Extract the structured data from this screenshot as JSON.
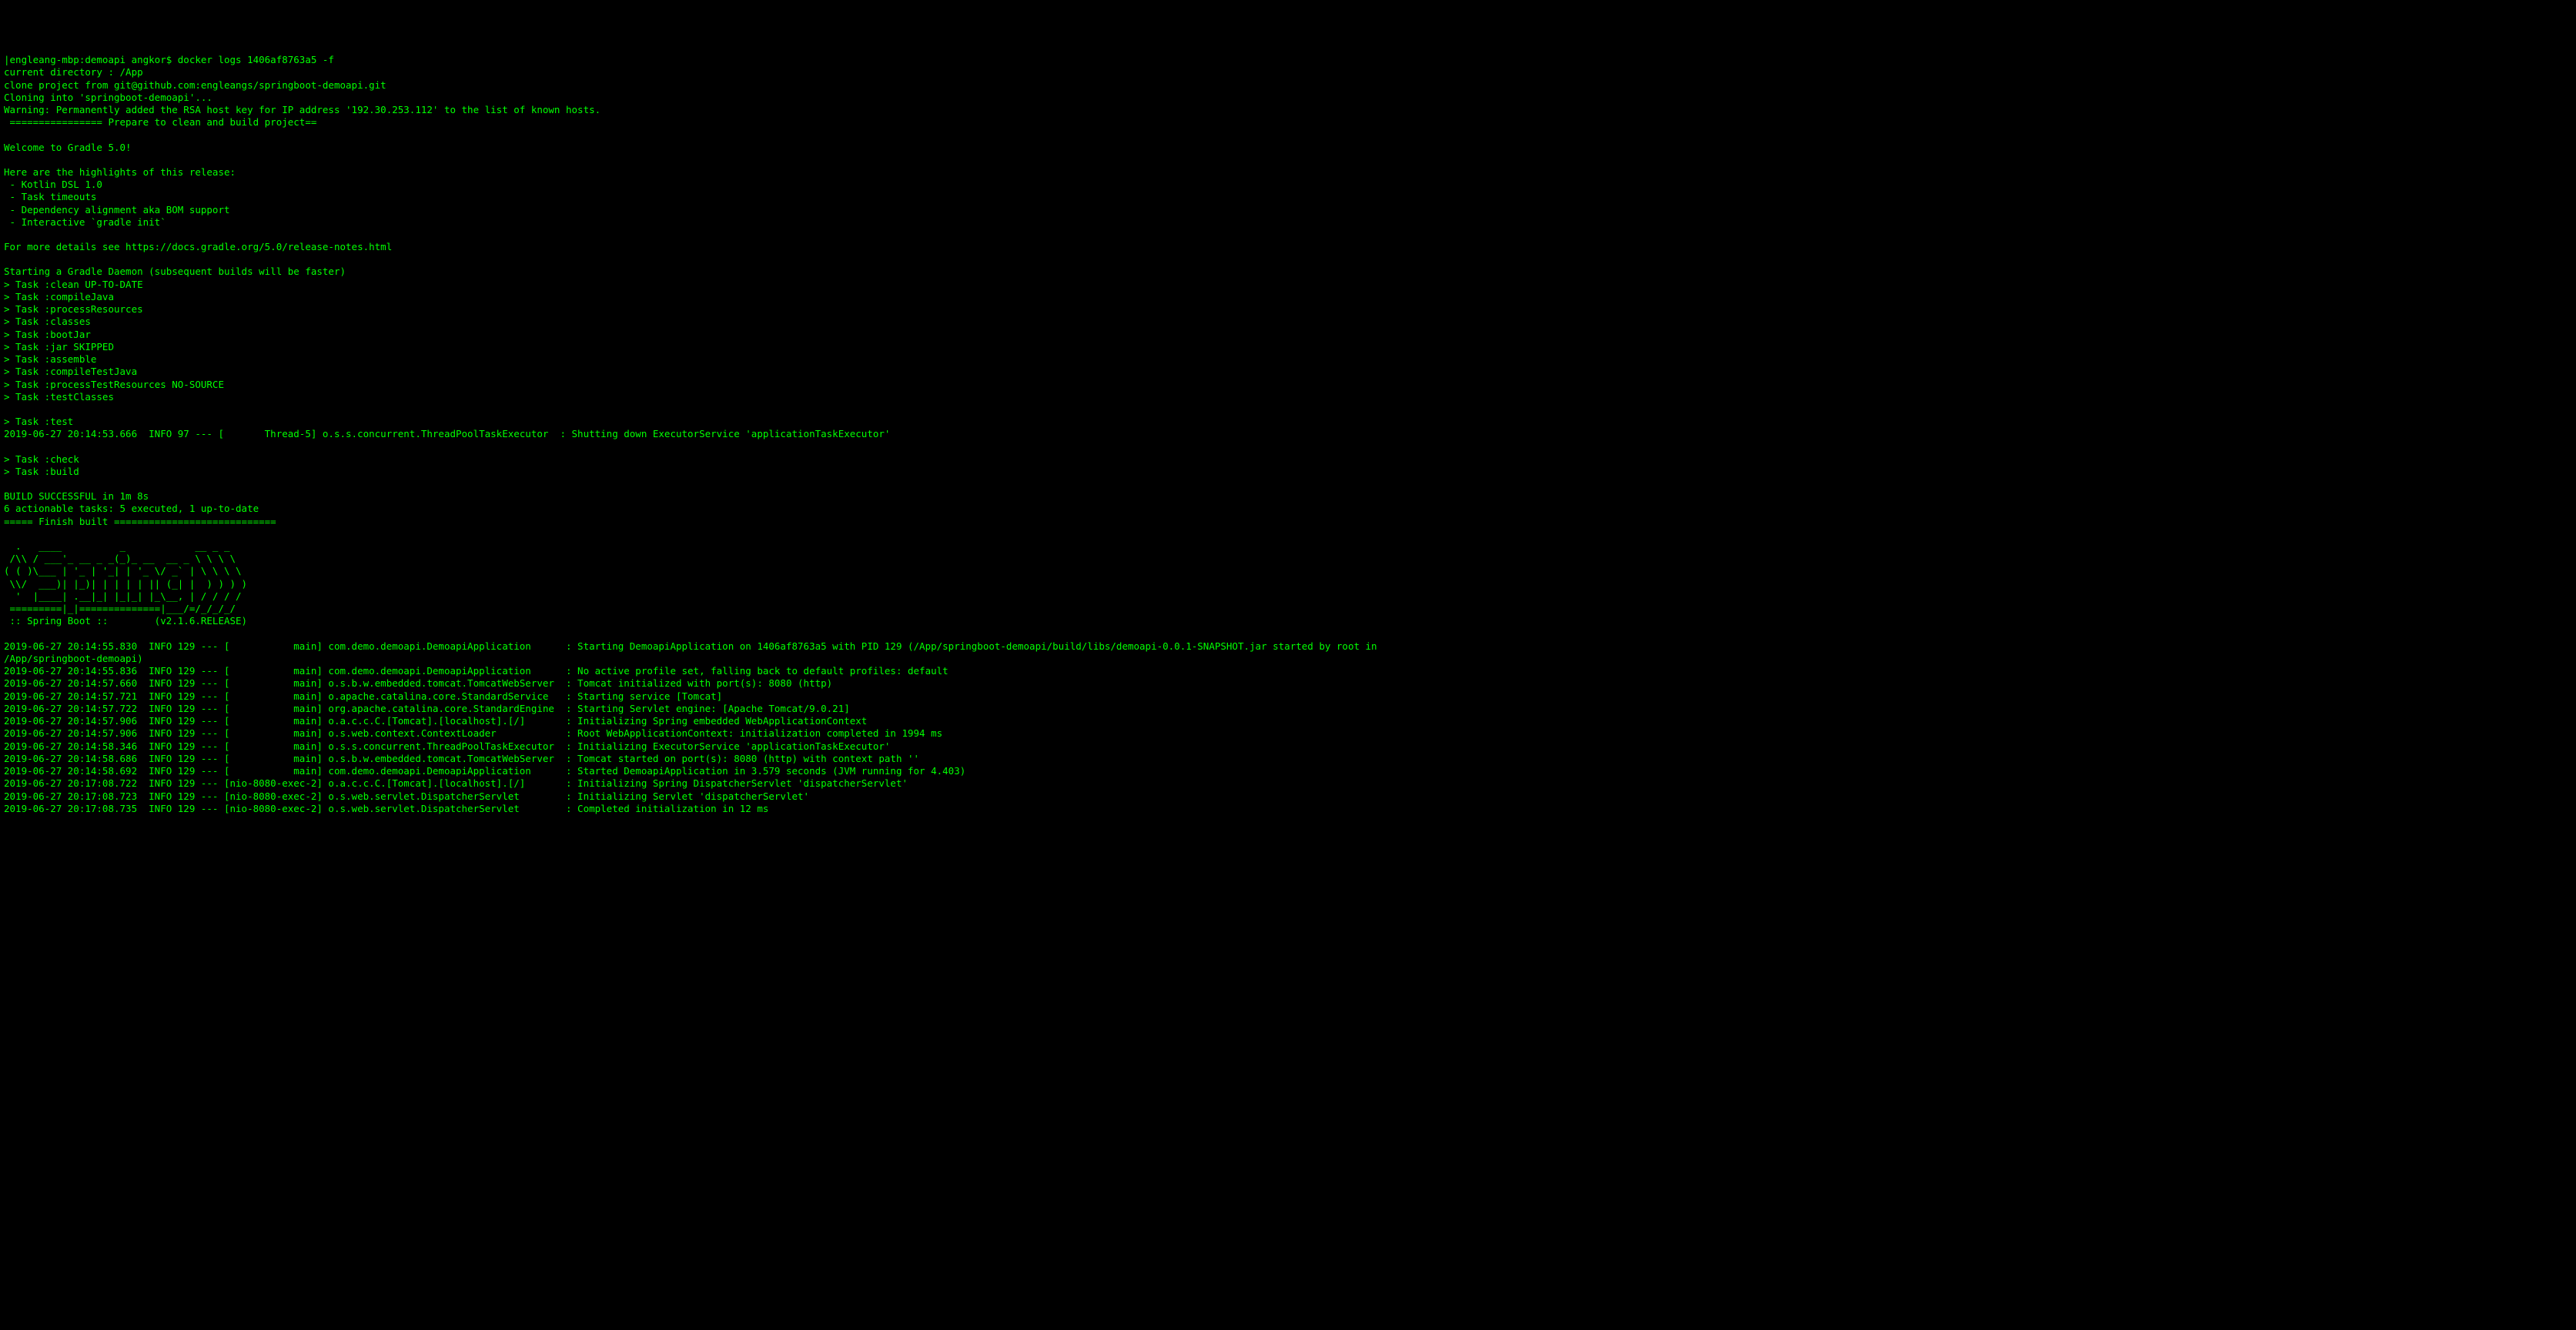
{
  "terminal": {
    "lines": [
      "|engleang-mbp:demoapi angkor$ docker logs 1406af8763a5 -f",
      "current directory : /App",
      "clone project from git@github.com:engleangs/springboot-demoapi.git",
      "Cloning into 'springboot-demoapi'...",
      "Warning: Permanently added the RSA host key for IP address '192.30.253.112' to the list of known hosts.",
      " ================ Prepare to clean and build project==",
      "",
      "Welcome to Gradle 5.0!",
      "",
      "Here are the highlights of this release:",
      " - Kotlin DSL 1.0",
      " - Task timeouts",
      " - Dependency alignment aka BOM support",
      " - Interactive `gradle init`",
      "",
      "For more details see https://docs.gradle.org/5.0/release-notes.html",
      "",
      "Starting a Gradle Daemon (subsequent builds will be faster)",
      "> Task :clean UP-TO-DATE",
      "> Task :compileJava",
      "> Task :processResources",
      "> Task :classes",
      "> Task :bootJar",
      "> Task :jar SKIPPED",
      "> Task :assemble",
      "> Task :compileTestJava",
      "> Task :processTestResources NO-SOURCE",
      "> Task :testClasses",
      "",
      "> Task :test",
      "2019-06-27 20:14:53.666  INFO 97 --- [       Thread-5] o.s.s.concurrent.ThreadPoolTaskExecutor  : Shutting down ExecutorService 'applicationTaskExecutor'",
      "",
      "> Task :check",
      "> Task :build",
      "",
      "BUILD SUCCESSFUL in 1m 8s",
      "6 actionable tasks: 5 executed, 1 up-to-date",
      "===== Finish built ============================",
      "",
      "  .   ____          _            __ _ _",
      " /\\\\ / ___'_ __ _ _(_)_ __  __ _ \\ \\ \\ \\",
      "( ( )\\___ | '_ | '_| | '_ \\/ _` | \\ \\ \\ \\",
      " \\\\/  ___)| |_)| | | | | || (_| |  ) ) ) )",
      "  '  |____| .__|_| |_|_| |_\\__, | / / / /",
      " =========|_|==============|___/=/_/_/_/",
      " :: Spring Boot ::        (v2.1.6.RELEASE)",
      "",
      "2019-06-27 20:14:55.830  INFO 129 --- [           main] com.demo.demoapi.DemoapiApplication      : Starting DemoapiApplication on 1406af8763a5 with PID 129 (/App/springboot-demoapi/build/libs/demoapi-0.0.1-SNAPSHOT.jar started by root in",
      "/App/springboot-demoapi)",
      "2019-06-27 20:14:55.836  INFO 129 --- [           main] com.demo.demoapi.DemoapiApplication      : No active profile set, falling back to default profiles: default",
      "2019-06-27 20:14:57.660  INFO 129 --- [           main] o.s.b.w.embedded.tomcat.TomcatWebServer  : Tomcat initialized with port(s): 8080 (http)",
      "2019-06-27 20:14:57.721  INFO 129 --- [           main] o.apache.catalina.core.StandardService   : Starting service [Tomcat]",
      "2019-06-27 20:14:57.722  INFO 129 --- [           main] org.apache.catalina.core.StandardEngine  : Starting Servlet engine: [Apache Tomcat/9.0.21]",
      "2019-06-27 20:14:57.906  INFO 129 --- [           main] o.a.c.c.C.[Tomcat].[localhost].[/]       : Initializing Spring embedded WebApplicationContext",
      "2019-06-27 20:14:57.906  INFO 129 --- [           main] o.s.web.context.ContextLoader            : Root WebApplicationContext: initialization completed in 1994 ms",
      "2019-06-27 20:14:58.346  INFO 129 --- [           main] o.s.s.concurrent.ThreadPoolTaskExecutor  : Initializing ExecutorService 'applicationTaskExecutor'",
      "2019-06-27 20:14:58.686  INFO 129 --- [           main] o.s.b.w.embedded.tomcat.TomcatWebServer  : Tomcat started on port(s): 8080 (http) with context path ''",
      "2019-06-27 20:14:58.692  INFO 129 --- [           main] com.demo.demoapi.DemoapiApplication      : Started DemoapiApplication in 3.579 seconds (JVM running for 4.403)",
      "2019-06-27 20:17:08.722  INFO 129 --- [nio-8080-exec-2] o.a.c.c.C.[Tomcat].[localhost].[/]       : Initializing Spring DispatcherServlet 'dispatcherServlet'",
      "2019-06-27 20:17:08.723  INFO 129 --- [nio-8080-exec-2] o.s.web.servlet.DispatcherServlet        : Initializing Servlet 'dispatcherServlet'",
      "2019-06-27 20:17:08.735  INFO 129 --- [nio-8080-exec-2] o.s.web.servlet.DispatcherServlet        : Completed initialization in 12 ms"
    ]
  }
}
